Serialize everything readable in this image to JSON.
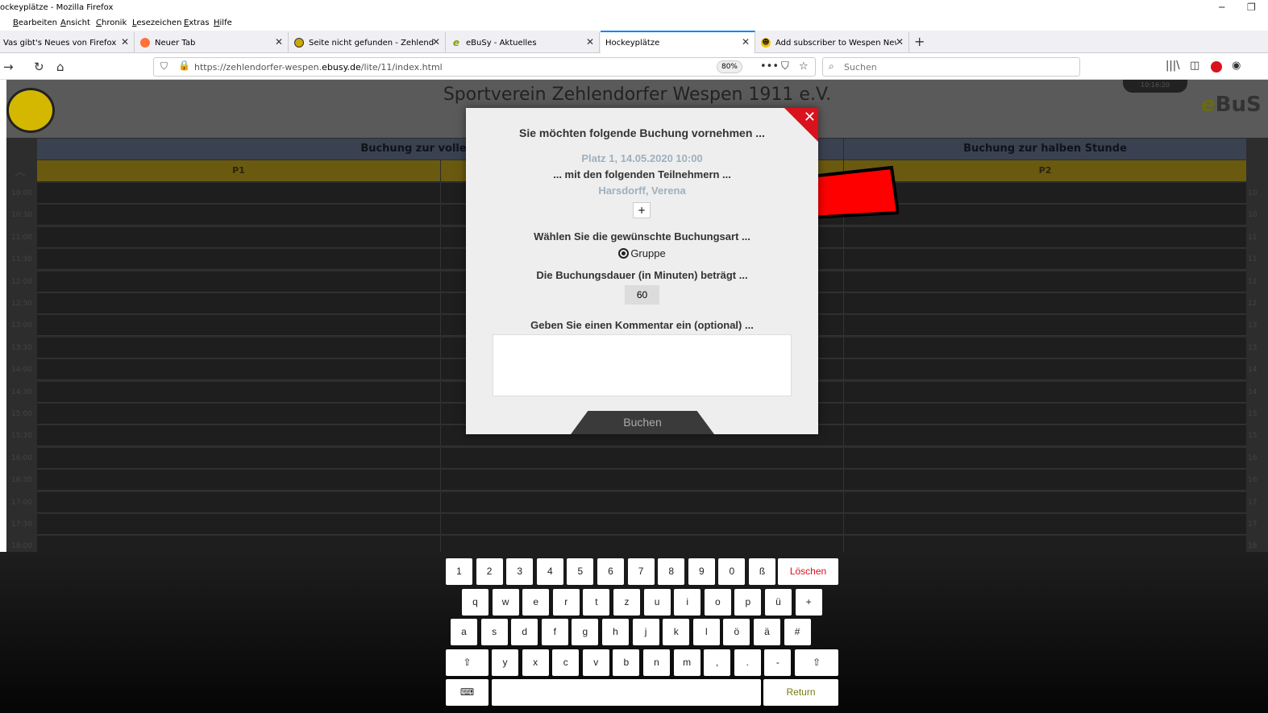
{
  "window": {
    "title": "ockeyplätze - Mozilla Firefox"
  },
  "menu": [
    "Bearbeiten",
    "Ansicht",
    "Chronik",
    "Lesezeichen",
    "Extras",
    "Hilfe"
  ],
  "tabs": [
    {
      "label": "Vas gibt's Neues von Firefox",
      "icon": "firefox-icon"
    },
    {
      "label": "Neuer Tab",
      "icon": "firefox-icon"
    },
    {
      "label": "Seite nicht gefunden - Zehlendorfer",
      "icon": "wespen-logo-icon"
    },
    {
      "label": "eBuSy - Aktuelles",
      "icon": "ebusy-icon"
    },
    {
      "label": "Hockeyplätze",
      "icon": ""
    },
    {
      "label": "Add subscriber to Wespen Newsletter",
      "icon": "mailchimp-icon"
    }
  ],
  "nav": {
    "url_prefix": "https://zehlendorfer-wespen.",
    "url_domain": "ebusy.de",
    "url_suffix": "/lite/11/index.html",
    "zoom": "80%",
    "search_placeholder": "Suchen"
  },
  "page": {
    "club_name": "Sportverein Zehlendorfer Wespen 1911 e.V.",
    "clock": "10:16:20",
    "brand_e": "e",
    "brand_rest": "BuS",
    "col_full": "Buchung zur vollen Stunde",
    "col_half": "Buchung zur halben Stunde",
    "p1": "P1",
    "p2": "P2",
    "times": [
      "10:00",
      "10:30",
      "11:00",
      "11:30",
      "12:00",
      "12:30",
      "13:00",
      "13:30",
      "14:00",
      "14:30",
      "15:00",
      "15:30",
      "16:00",
      "16:30",
      "17:00",
      "17:30",
      "18:00"
    ],
    "times_right": [
      "10",
      "10",
      "11",
      "11",
      "12",
      "12",
      "13",
      "13",
      "14",
      "14",
      "15",
      "15",
      "16",
      "16",
      "17",
      "17",
      "18"
    ]
  },
  "modal": {
    "title": "Sie möchten folgende Buchung vornehmen ...",
    "slot": "Platz 1, 14.05.2020 10:00",
    "participants_label": "... mit den folgenden Teilnehmern ...",
    "participant": "Harsdorff, Verena",
    "add_label": "+",
    "type_label": "Wählen Sie die gewünschte Buchungsart ...",
    "type_option": "Gruppe",
    "duration_label": "Die Buchungsdauer (in Minuten) beträgt ...",
    "duration": "60",
    "comment_label": "Geben Sie einen Kommentar ein (optional) ...",
    "submit": "Buchen"
  },
  "keyboard": {
    "row1": [
      "1",
      "2",
      "3",
      "4",
      "5",
      "6",
      "7",
      "8",
      "9",
      "0",
      "ß"
    ],
    "delete": "Löschen",
    "row2": [
      "q",
      "w",
      "e",
      "r",
      "t",
      "z",
      "u",
      "i",
      "o",
      "p",
      "ü",
      "+"
    ],
    "row3": [
      "a",
      "s",
      "d",
      "f",
      "g",
      "h",
      "j",
      "k",
      "l",
      "ö",
      "ä",
      "#"
    ],
    "shift": "⇧",
    "row4": [
      "y",
      "x",
      "c",
      "v",
      "b",
      "n",
      "m",
      ",",
      ".",
      "-"
    ],
    "return": "Return"
  },
  "colors": {
    "accent": "#0a84ff",
    "close": "#d9121d",
    "arrow": "#ff0000"
  }
}
